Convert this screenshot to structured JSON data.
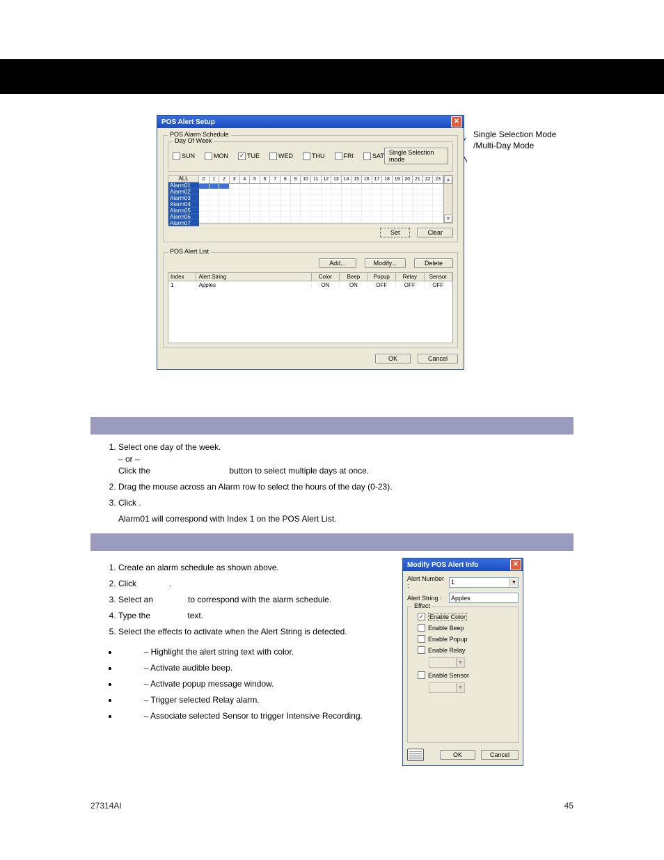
{
  "blackbar_caption": "",
  "callout": {
    "line1": "Single Selection Mode",
    "line2": "/Multi-Day Mode"
  },
  "pos_alert_setup": {
    "title": "POS Alert Setup",
    "group_schedule": "POS Alarm Schedule",
    "group_dow": "Day Of Week",
    "days": [
      "SUN",
      "MON",
      "TUE",
      "WED",
      "THU",
      "FRI",
      "SAT"
    ],
    "checked_day": "TUE",
    "single_sel_btn": "Single Selection mode",
    "row_header": "ALL",
    "hours": [
      "0",
      "1",
      "2",
      "3",
      "4",
      "5",
      "6",
      "7",
      "8",
      "9",
      "10",
      "11",
      "12",
      "13",
      "14",
      "15",
      "16",
      "17",
      "18",
      "19",
      "20",
      "21",
      "22",
      "23"
    ],
    "alarm_rows": [
      "Alarm01",
      "Alarm02",
      "Alarm03",
      "Alarm04",
      "Alarm05",
      "Alarm06",
      "Alarm07"
    ],
    "set_btn": "Set",
    "clear_btn": "Clear",
    "group_alert_list": "POS Alert List",
    "add_btn": "Add...",
    "modify_btn": "Modify...",
    "delete_btn": "Delete",
    "columns": [
      "Index",
      "Alert String",
      "Color",
      "Beep",
      "Popup",
      "Relay",
      "Sensor"
    ],
    "rows": [
      {
        "index": "1",
        "string": "Apples",
        "color": "ON",
        "beep": "ON",
        "popup": "OFF",
        "relay": "OFF",
        "sensor": "OFF"
      }
    ],
    "ok_btn": "OK",
    "cancel_btn": "Cancel"
  },
  "section1_steps": [
    {
      "n": "1",
      "text": "Select one day of the week.",
      "sub1": "– or –",
      "sub2_prefix": "Click the ",
      "sub2_suffix": " button to select multiple days at once."
    },
    {
      "n": "2",
      "text": "Drag the mouse across an Alarm row to select the hours of the day (0-23)."
    },
    {
      "n": "3",
      "text": "Click",
      "text2": ".",
      "note": "Alarm01 will correspond with Index 1 on the POS Alert List."
    }
  ],
  "section2_steps": [
    {
      "n": "1",
      "text": "Create an alarm schedule as shown above."
    },
    {
      "n": "2",
      "text": "Click",
      "text2": "."
    },
    {
      "n": "3",
      "text": "Select an",
      "text2": " to correspond with the alarm schedule."
    },
    {
      "n": "4",
      "text": "Type the ",
      "text2": " text."
    },
    {
      "n": "5",
      "text": "Select the effects to activate when the Alert String is detected."
    }
  ],
  "bullets": [
    " – Highlight the alert string text with color.",
    " – Activate audible beep.",
    " – Activate popup message window.",
    " – Trigger selected Relay alarm.",
    " – Associate selected Sensor to trigger Intensive Recording."
  ],
  "modify_win": {
    "title": "Modify POS Alert Info",
    "alert_number_label": "Alert Number :",
    "alert_number_value": "1",
    "alert_string_label": "Alert String :",
    "alert_string_value": "Apples",
    "effect_legend": "Effect",
    "effects": [
      {
        "label": "Enable Color",
        "checked": true,
        "underline": true
      },
      {
        "label": "Enable Beep",
        "checked": false
      },
      {
        "label": "Enable Popup",
        "checked": false
      },
      {
        "label": "Enable Relay",
        "checked": false,
        "combo": true
      },
      {
        "label": "Enable Sensor",
        "checked": false,
        "combo": true
      }
    ],
    "ok_btn": "OK",
    "cancel_btn": "Cancel"
  },
  "footer": {
    "left": "27314AI",
    "right": "45"
  }
}
